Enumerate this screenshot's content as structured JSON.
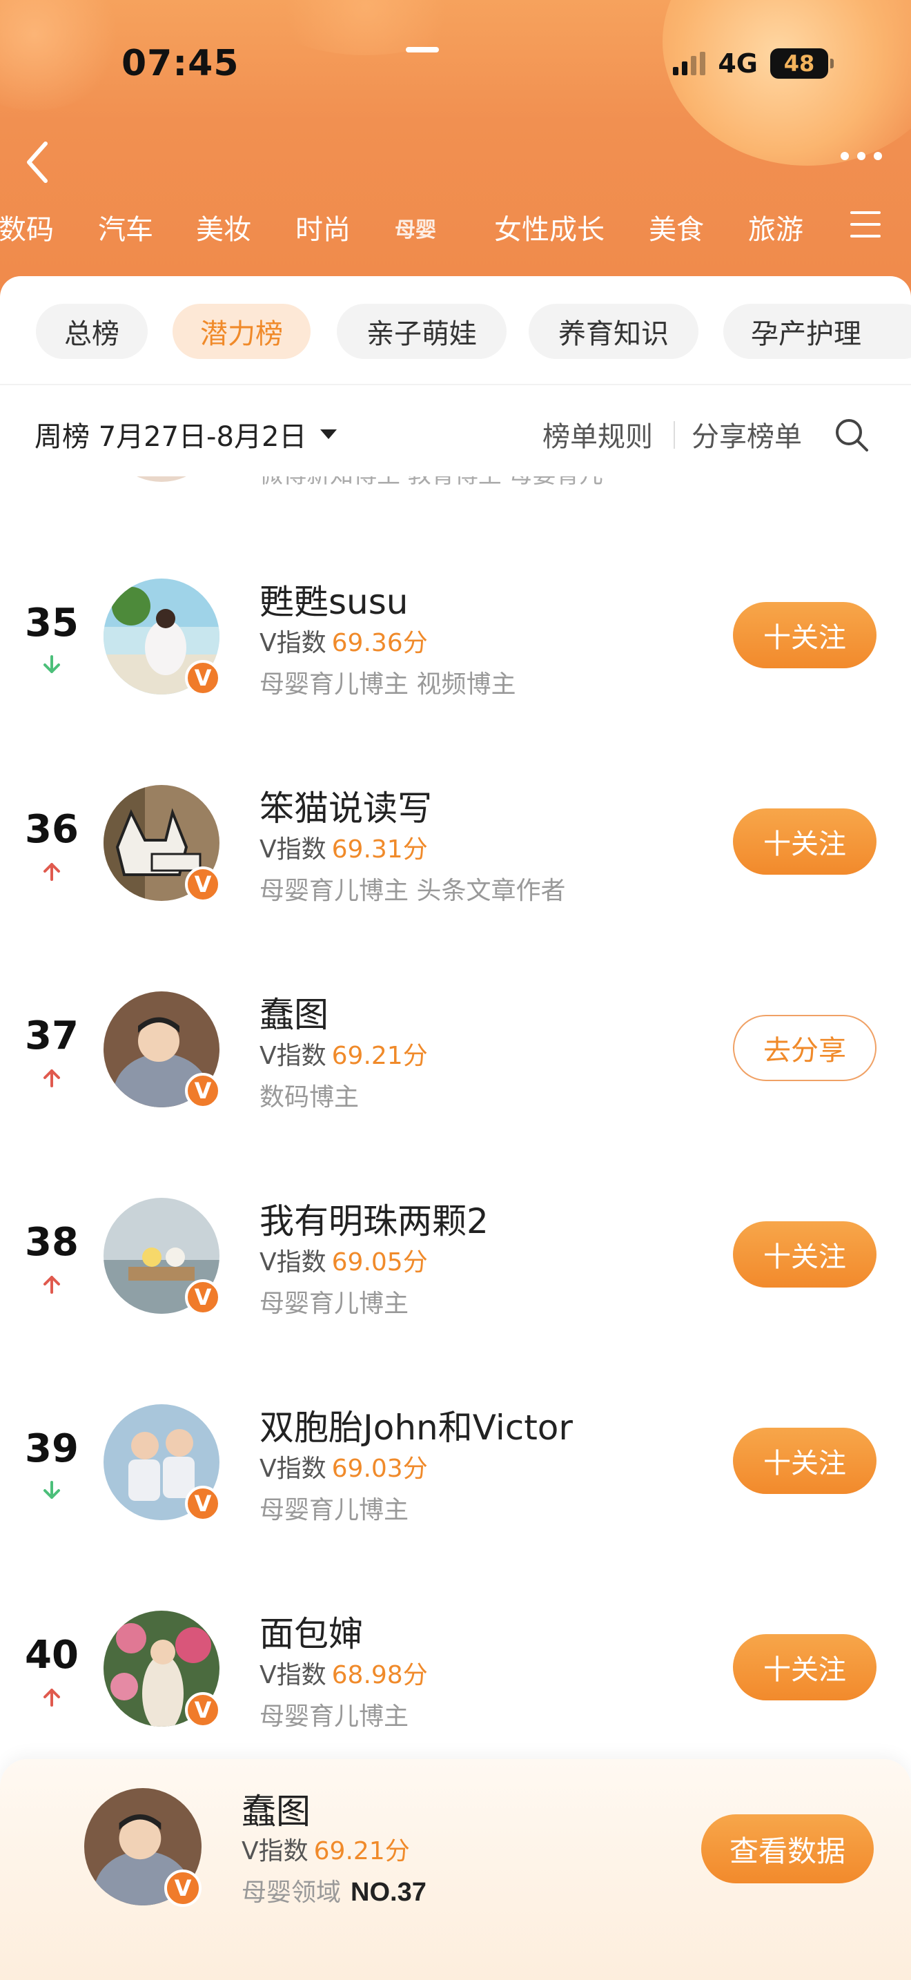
{
  "status": {
    "time": "07:45",
    "network": "4G",
    "battery": "48"
  },
  "header": {
    "categories": [
      "数码",
      "汽车",
      "美妆",
      "时尚",
      "母婴",
      "女性成长",
      "美食",
      "旅游"
    ],
    "active_category": "母婴"
  },
  "sub_tabs": [
    "总榜",
    "潜力榜",
    "亲子萌娃",
    "养育知识",
    "孕产护理"
  ],
  "active_sub_tab": "潜力榜",
  "period": {
    "label": "周榜 7月27日-8月2日",
    "rules": "榜单规则",
    "share": "分享榜单"
  },
  "partial_row": {
    "text": "微博新知博主 教育博主 母婴育儿"
  },
  "rows": [
    {
      "rank": "35",
      "trend": "down",
      "name": "甦甦susu",
      "vindex_label": "V指数",
      "score": "69.36分",
      "tags": "母婴育儿博主 视频博主",
      "button": "十关注",
      "button_type": "follow"
    },
    {
      "rank": "36",
      "trend": "up",
      "name": "笨猫说读写",
      "vindex_label": "V指数",
      "score": "69.31分",
      "tags": "母婴育儿博主 头条文章作者",
      "button": "十关注",
      "button_type": "follow"
    },
    {
      "rank": "37",
      "trend": "up",
      "name": "蠢图",
      "vindex_label": "V指数",
      "score": "69.21分",
      "tags": "数码博主",
      "button": "去分享",
      "button_type": "share"
    },
    {
      "rank": "38",
      "trend": "up",
      "name": "我有明珠两颗2",
      "vindex_label": "V指数",
      "score": "69.05分",
      "tags": "母婴育儿博主",
      "button": "十关注",
      "button_type": "follow"
    },
    {
      "rank": "39",
      "trend": "down",
      "name": "双胞胎John和Victor",
      "vindex_label": "V指数",
      "score": "69.03分",
      "tags": "母婴育儿博主",
      "button": "十关注",
      "button_type": "follow"
    },
    {
      "rank": "40",
      "trend": "up",
      "name": "面包婶",
      "vindex_label": "V指数",
      "score": "68.98分",
      "tags": "母婴育儿博主",
      "button": "十关注",
      "button_type": "follow"
    }
  ],
  "badge_letter": "V",
  "bottom": {
    "name": "蠢图",
    "vindex_label": "V指数",
    "score": "69.21分",
    "domain": "母婴领域",
    "rank": "NO.37",
    "button": "查看数据"
  },
  "colors": {
    "accent": "#f28a2c",
    "up": "#e05a4e",
    "down": "#4cbf7a"
  }
}
